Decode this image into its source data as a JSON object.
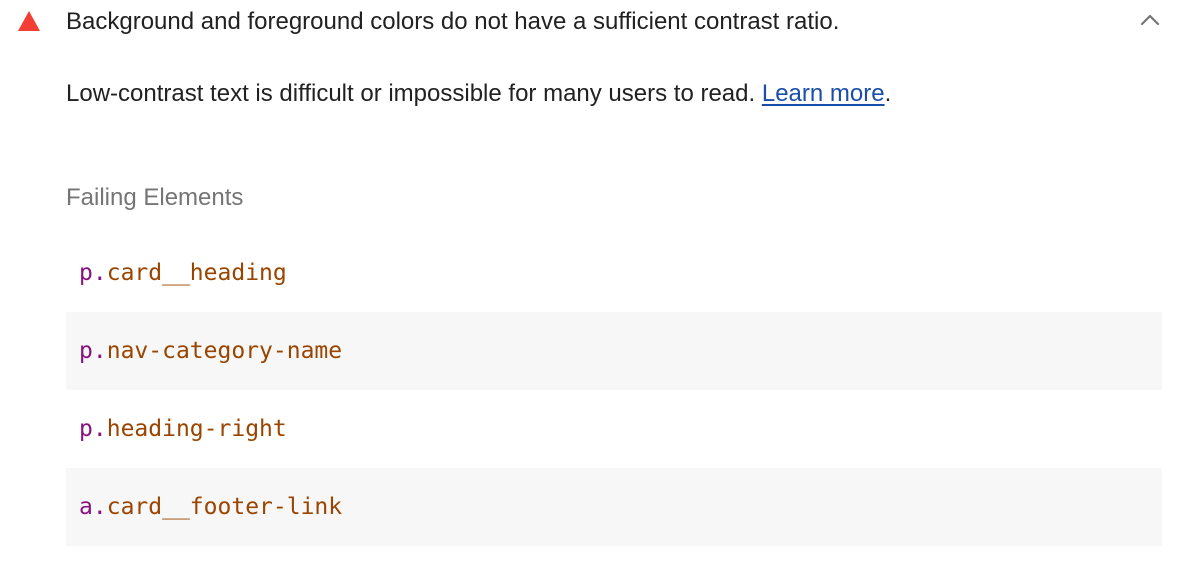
{
  "audit": {
    "status": "fail",
    "status_color": "#f33e35",
    "title": "Background and foreground colors do not have a sufficient contrast ratio.",
    "expanded": true,
    "toggle_icon": "chevron-up-icon",
    "description": "Low-contrast text is difficult or impossible for many users to read. ",
    "learn_more_label": "Learn more",
    "description_suffix": ".",
    "link_color": "#1a4eaa"
  },
  "failing_elements": {
    "heading": "Failing Elements",
    "rows": [
      {
        "tag": "p",
        "dot": ".",
        "cls": "card__heading"
      },
      {
        "tag": "p",
        "dot": ".",
        "cls": "nav-category-name"
      },
      {
        "tag": "p",
        "dot": ".",
        "cls": "heading-right"
      },
      {
        "tag": "a",
        "dot": ".",
        "cls": "card__footer-link"
      }
    ]
  }
}
